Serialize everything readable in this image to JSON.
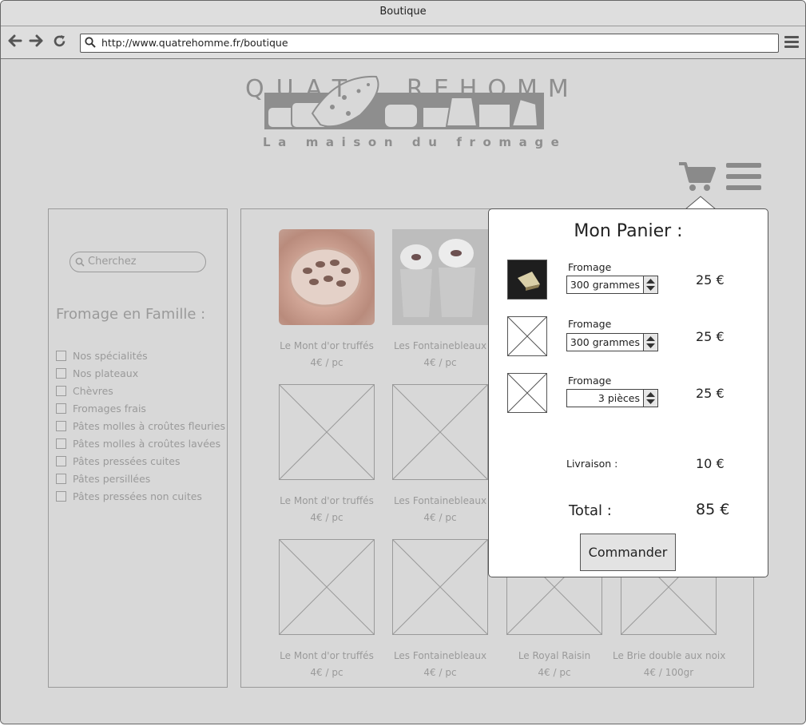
{
  "window": {
    "title": "Boutique"
  },
  "browser": {
    "url": "http://www.quatrehomme.fr/boutique"
  },
  "logo": {
    "brand": "QUATREHOMME",
    "tagline": "La maison du fromage"
  },
  "sidebar": {
    "search_placeholder": "Cherchez",
    "title": "Fromage en Famille :",
    "families": [
      "Nos spécialités",
      "Nos plateaux",
      "Chèvres",
      "Fromages frais",
      "Pâtes molles à croûtes fleuries",
      "Pâtes molles à croûtes lavées",
      "Pâtes pressées cuites",
      "Pâtes persillées",
      "Pâtes pressées non cuites"
    ]
  },
  "products": [
    {
      "name": "Le Mont d'or truffés",
      "price": "4€ / pc",
      "image": "photo-mont-dor"
    },
    {
      "name": "Les Fontainebleaux",
      "price": "4€ / pc",
      "image": "photo-fontainebleau"
    },
    {
      "name": "Le Mont d'or truffés",
      "price": "4€ / pc",
      "image": "placeholder"
    },
    {
      "name": "Les Fontainebleaux",
      "price": "4€ / pc",
      "image": "placeholder"
    },
    {
      "name": "Le Mont d'or truffés",
      "price": "4€ / pc",
      "image": "placeholder"
    },
    {
      "name": "Les Fontainebleaux",
      "price": "4€ / pc",
      "image": "placeholder"
    },
    {
      "name": "Le Royal Raisin",
      "price": "4€ / pc",
      "image": "placeholder"
    },
    {
      "name": "Le Brie double aux noix",
      "price": "4€ / 100gr",
      "image": "placeholder"
    }
  ],
  "cart": {
    "title": "Mon Panier :",
    "items": [
      {
        "label": "Fromage",
        "quantity": "300 grammes",
        "price": "25 €",
        "image": "cheese-photo"
      },
      {
        "label": "Fromage",
        "quantity": "300 grammes",
        "price": "25 €",
        "image": "placeholder"
      },
      {
        "label": "Fromage",
        "quantity": "3 pièces",
        "price": "25 €",
        "image": "placeholder"
      }
    ],
    "shipping_label": "Livraison :",
    "shipping_value": "10 €",
    "total_label": "Total :",
    "total_value": "85 €",
    "order_button": "Commander"
  },
  "icons": [
    "back-arrow-icon",
    "forward-arrow-icon",
    "reload-icon",
    "search-icon",
    "menu-icon",
    "cart-icon"
  ],
  "colors": {
    "background": "#d8d8d8",
    "muted_text": "#9a9a9a",
    "popup_bg": "#ffffff"
  }
}
